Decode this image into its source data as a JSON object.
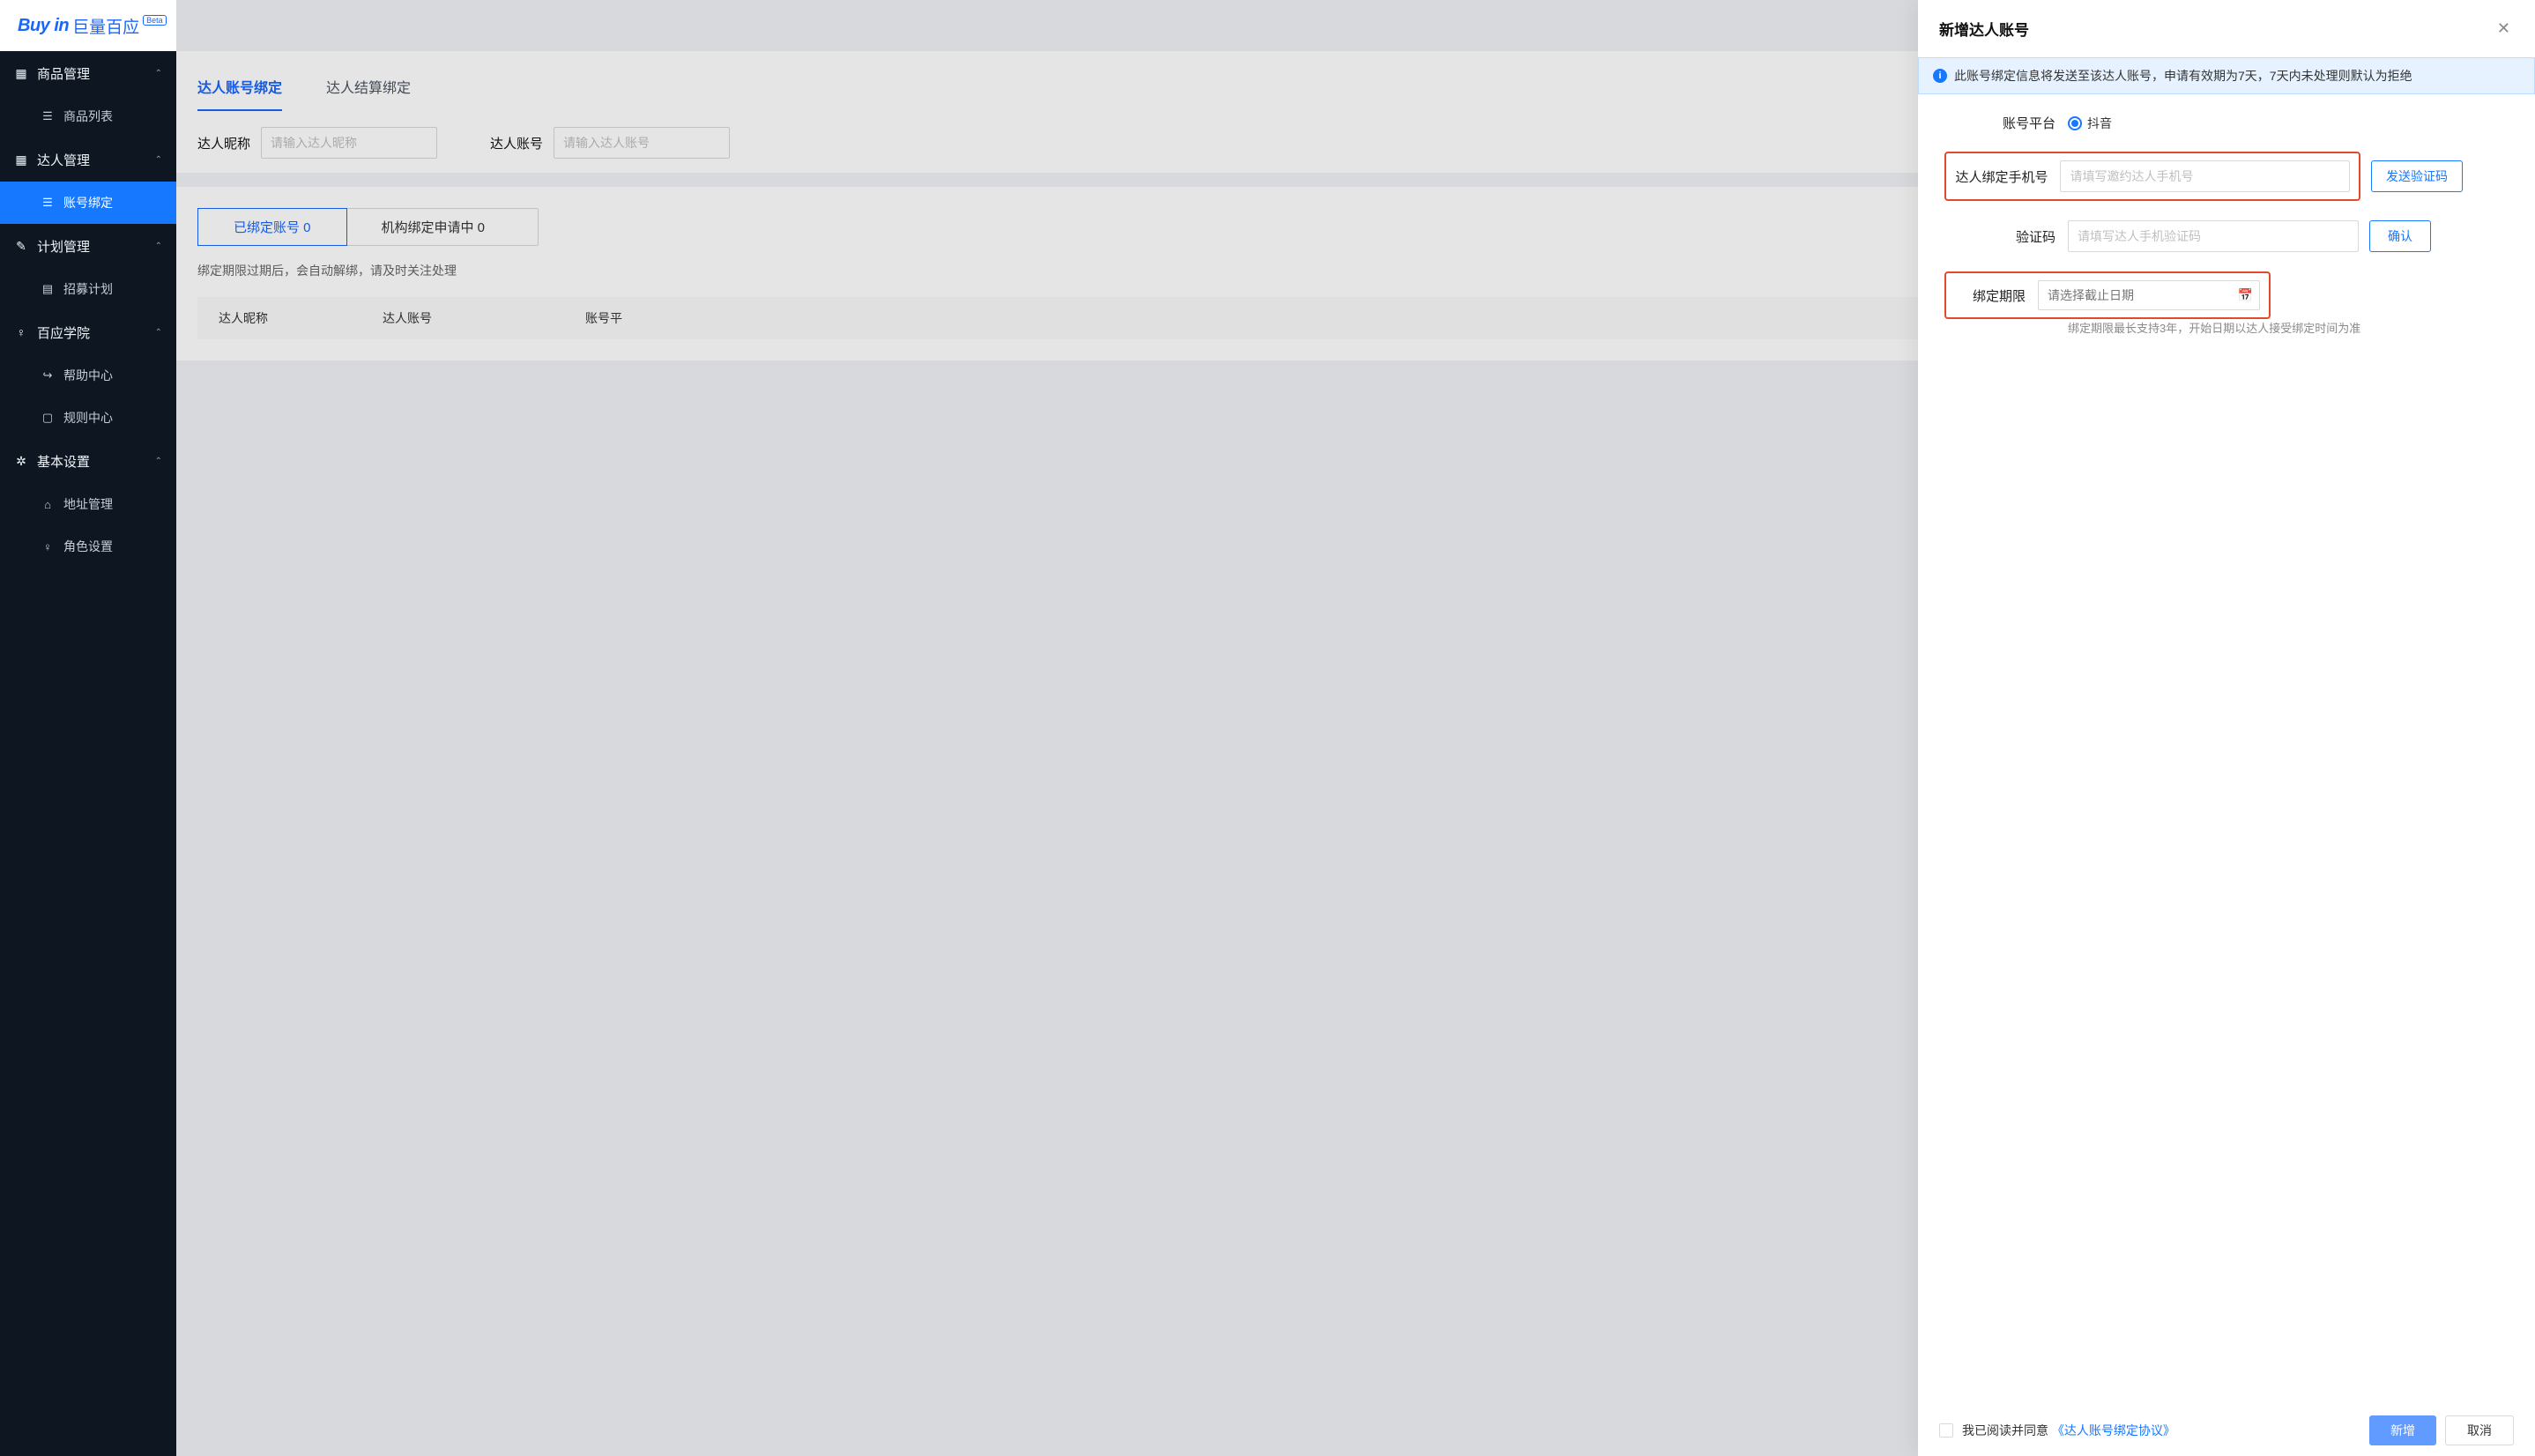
{
  "brand": {
    "logo_en": "Buy in",
    "logo_cn": "巨量百应",
    "beta": "Beta"
  },
  "sidebar": {
    "groups": [
      {
        "title": "商品管理",
        "items": [
          "商品列表"
        ]
      },
      {
        "title": "达人管理",
        "items": [
          "账号绑定"
        ],
        "active_item": 0
      },
      {
        "title": "计划管理",
        "items": [
          "招募计划"
        ]
      },
      {
        "title": "百应学院",
        "items": [
          "帮助中心",
          "规则中心"
        ]
      },
      {
        "title": "基本设置",
        "items": [
          "地址管理",
          "角色设置"
        ]
      }
    ]
  },
  "page": {
    "tabs": [
      "达人账号绑定",
      "达人结算绑定"
    ],
    "filter_nick_label": "达人昵称",
    "filter_nick_ph": "请输入达人昵称",
    "filter_acct_label": "达人账号",
    "filter_acct_ph": "请输入达人账号",
    "sub_tabs": [
      "已绑定账号 0",
      "机构绑定申请中 0"
    ],
    "hint": "绑定期限过期后，会自动解绑，请及时关注处理",
    "table_headers": [
      "达人昵称",
      "达人账号",
      "账号平"
    ]
  },
  "drawer": {
    "title": "新增达人账号",
    "alert": "此账号绑定信息将发送至该达人账号，申请有效期为7天，7天内未处理则默认为拒绝",
    "platform_label": "账号平台",
    "platform_option": "抖音",
    "phone_label": "达人绑定手机号",
    "phone_ph": "请填写邀约达人手机号",
    "send_code_btn": "发送验证码",
    "code_label": "验证码",
    "code_ph": "请填写达人手机验证码",
    "confirm_btn": "确认",
    "period_label": "绑定期限",
    "period_ph": "请选择截止日期",
    "period_help": "绑定期限最长支持3年，开始日期以达人接受绑定时间为准",
    "agree_prefix": "我已阅读并同意",
    "agree_link": "《达人账号绑定协议》",
    "add_btn": "新增",
    "cancel_btn": "取消"
  }
}
